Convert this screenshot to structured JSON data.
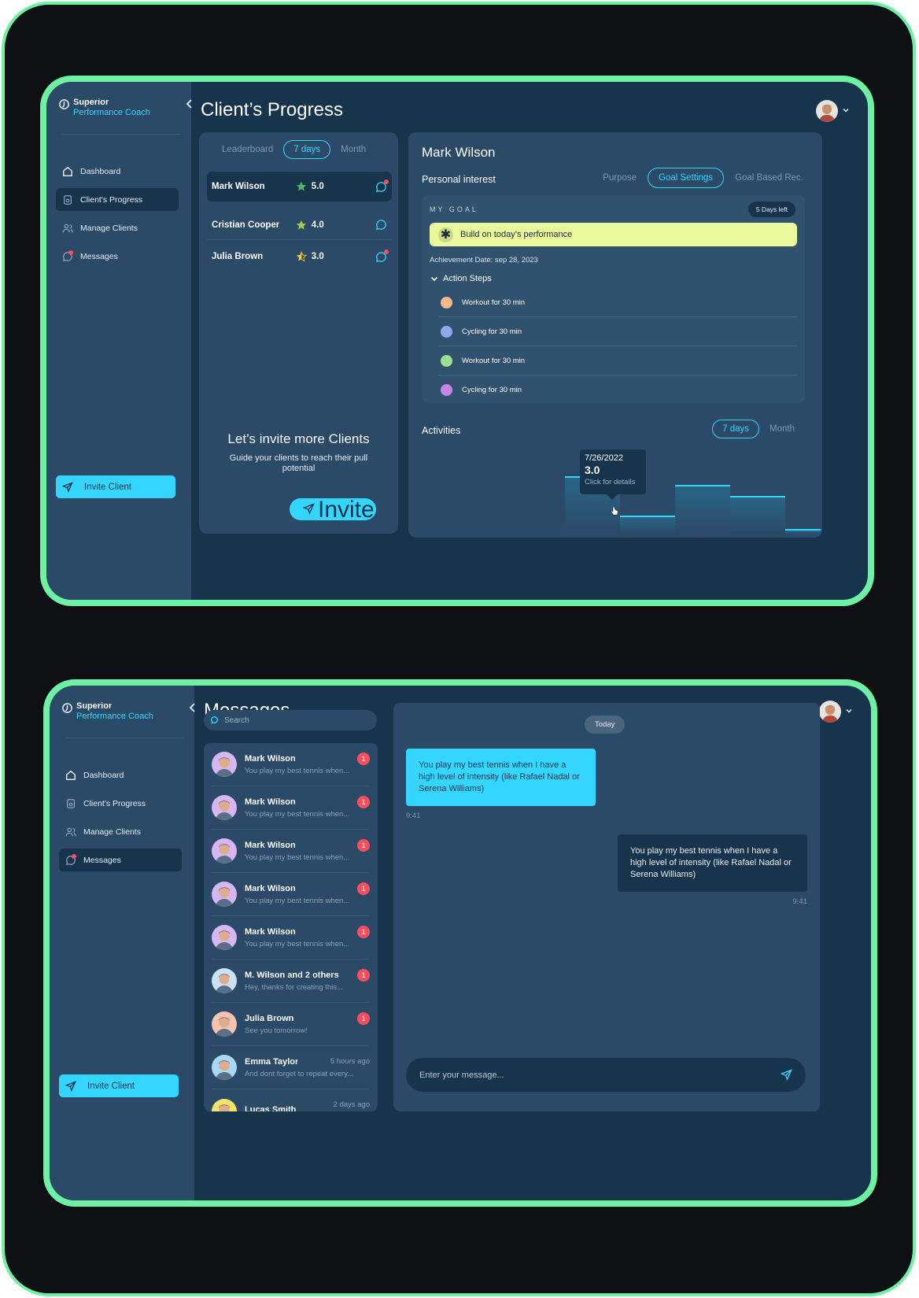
{
  "brand": {
    "line1": "Superior",
    "line2": "Performance Coach"
  },
  "nav": [
    {
      "label": "Dashboard"
    },
    {
      "label": "Client's Progress"
    },
    {
      "label": "Manage Clients"
    },
    {
      "label": "Messages"
    }
  ],
  "invite_button": "Invite Client",
  "progress": {
    "title": "Client’s Progress",
    "leaderboard": {
      "tabs": [
        "Leaderboard",
        "7 days",
        "Month"
      ],
      "rows": [
        {
          "name": "Mark Wilson",
          "rating": "5.0"
        },
        {
          "name": "Cristian Cooper",
          "rating": "4.0"
        },
        {
          "name": "Julia Brown",
          "rating": "3.0"
        }
      ],
      "invite_heading": "Let’s invite more Clients",
      "invite_desc": "Guide your clients to reach their pull potential",
      "invite_cta": "Invite"
    },
    "detail": {
      "name": "Mark Wilson",
      "personal_interest": "Personal interest",
      "tabs": [
        "Purpose",
        "Goal Settings",
        "Goal Based Rec."
      ],
      "goal_label": "MY GOAL",
      "days_left": "5 Days left",
      "goal": "Build on today’s performance",
      "achievement_date": "Achievement Date: sep 28, 2023",
      "action_steps_label": "Action Steps",
      "steps": [
        {
          "label": "Workout for 30 min",
          "color": "#f6b98a"
        },
        {
          "label": "Cycling for 30 min",
          "color": "#8fa8f2"
        },
        {
          "label": "Workout for 30 min",
          "color": "#9be08f"
        },
        {
          "label": "Cycling for 30 min",
          "color": "#c985e6"
        }
      ],
      "activities_label": "Activities",
      "activity_tabs": [
        "7 days",
        "Month"
      ],
      "tooltip": {
        "date": "7/26/2022",
        "value": "3.0",
        "hint": "Click for details"
      }
    }
  },
  "chart_data": {
    "type": "bar",
    "title": "Activities",
    "values": [
      4.2,
      1.4,
      3.6,
      2.8,
      0.4
    ],
    "highlight": {
      "date": "7/26/2022",
      "value": 3.0
    },
    "ylim": [
      0,
      6
    ],
    "accent": "#34d6ff"
  },
  "messages": {
    "title": "Messages",
    "search_placeholder": "Search",
    "list": [
      {
        "name": "Mark Wilson",
        "preview": "You play my best tennis when...",
        "badge": "1"
      },
      {
        "name": "Mark Wilson",
        "preview": "You play my best tennis when...",
        "badge": "1"
      },
      {
        "name": "Mark Wilson",
        "preview": "You play my best tennis when...",
        "badge": "1"
      },
      {
        "name": "Mark Wilson",
        "preview": "You play my best tennis when...",
        "badge": "1"
      },
      {
        "name": "Mark Wilson",
        "preview": "You play my best tennis when...",
        "badge": "1"
      },
      {
        "name": "M. Wilson and 2 others",
        "preview": "Hey, thanks for creating this...",
        "badge": "1"
      },
      {
        "name": "Julia Brown",
        "preview": "See you tomorrow!",
        "badge": "1"
      },
      {
        "name": "Emma Taylor",
        "preview": "And dont forget to repeat every...",
        "time": "5 hours ago"
      },
      {
        "name": "Lucas Smith",
        "preview": "",
        "time": "2 days ago"
      }
    ],
    "chat": {
      "today": "Today",
      "incoming": "You play my best tennis when I have a high level of intensity (like Rafael Nadal or Serena Williams)",
      "incoming_time": "9:41",
      "outgoing": "You play my best tennis when I have a high level of intensity (like Rafael Nadal or Serena Williams)",
      "outgoing_time": "9:41",
      "input_placeholder": "Enter your message..."
    }
  }
}
